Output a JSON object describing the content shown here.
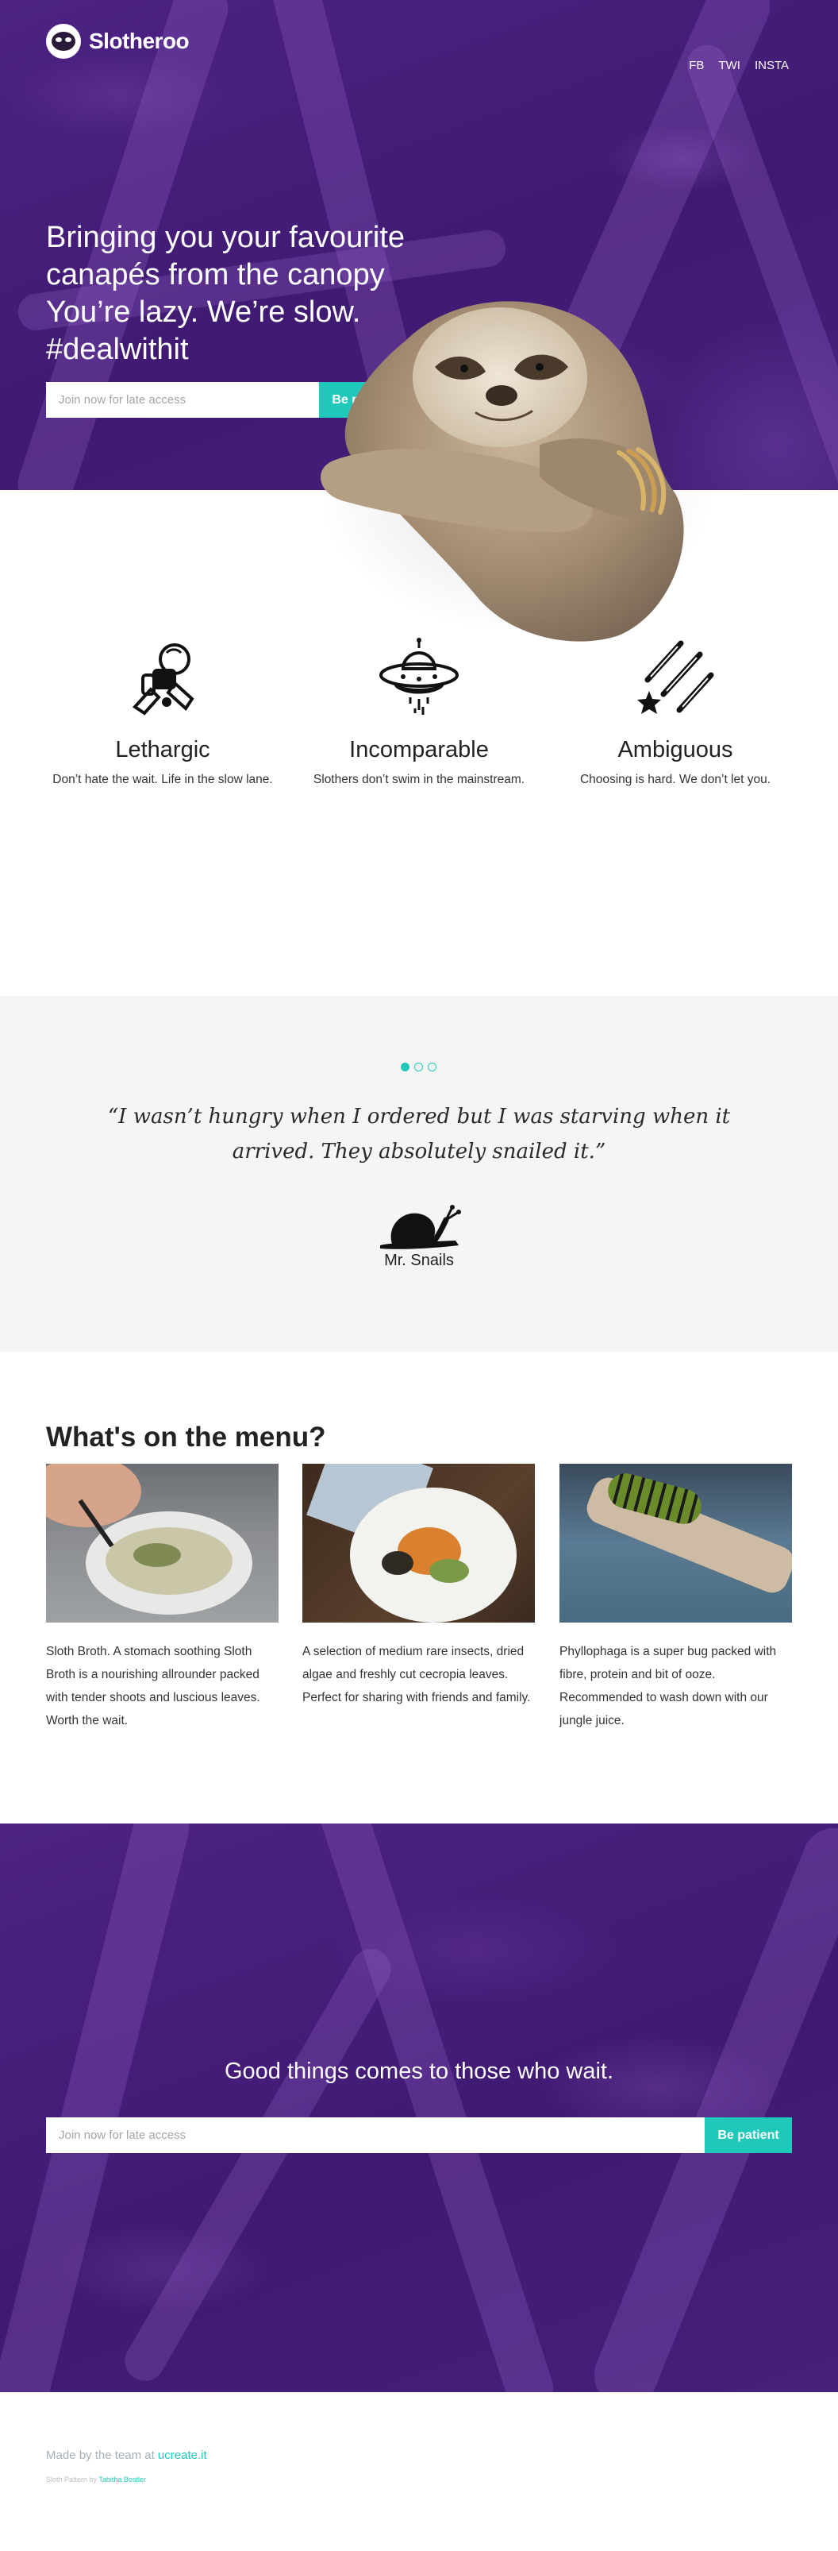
{
  "brand": {
    "name": "Slotheroo"
  },
  "nav": {
    "links": [
      "FB",
      "TWI",
      "INSTA"
    ]
  },
  "hero": {
    "headline": "Bringing you your favourite canapés from the canopy You’re lazy. We’re slow. #dealwithit",
    "input_placeholder": "Join now for late access",
    "button_label": "Be patient"
  },
  "features": [
    {
      "title": "Lethargic",
      "text": "Don’t hate the wait. Life in the slow lane.",
      "icon": "astronaut-icon"
    },
    {
      "title": "Incomparable",
      "text": "Slothers don’t swim in the mainstream.",
      "icon": "ufo-icon"
    },
    {
      "title": "Ambiguous",
      "text": "Choosing is hard. We don’t let you.",
      "icon": "shooting-stars-icon"
    }
  ],
  "testimonial": {
    "slides": 3,
    "active_slide": 1,
    "quote": "“I wasn’t hungry when I ordered but I was starving when it arrived. They absolutely snailed it.”",
    "author": "Mr. Snails",
    "icon": "snail-icon"
  },
  "menu": {
    "title": "What's on the menu?",
    "items": [
      {
        "image": "soup-bowl-photo",
        "text": "Sloth Broth. A stomach soothing Sloth Broth is a nourishing allrounder packed with tender shoots and luscious leaves. Worth the wait."
      },
      {
        "image": "salad-plate-photo",
        "text": "A selection of medium rare insects, dried algae and freshly cut cecropia leaves. Perfect for sharing with friends and family."
      },
      {
        "image": "caterpillar-photo",
        "text": "Phyllophaga is a super bug packed with fibre, protein and bit of ooze. Recommended to wash down with our jungle juice."
      }
    ]
  },
  "cta": {
    "title": "Good things comes to those who wait.",
    "input_placeholder": "Join now for late access",
    "button_label": "Be patient"
  },
  "footer": {
    "made_by_prefix": "Made by the team at ",
    "made_by_link": "ucreate.it",
    "credit_prefix": "Sloth Pattern by ",
    "credit_link": "Tabitha Bostler"
  },
  "colors": {
    "accent": "#1fc8b9",
    "hero_purple": "#44207a",
    "testimonial_bg": "#f5f5f5"
  }
}
